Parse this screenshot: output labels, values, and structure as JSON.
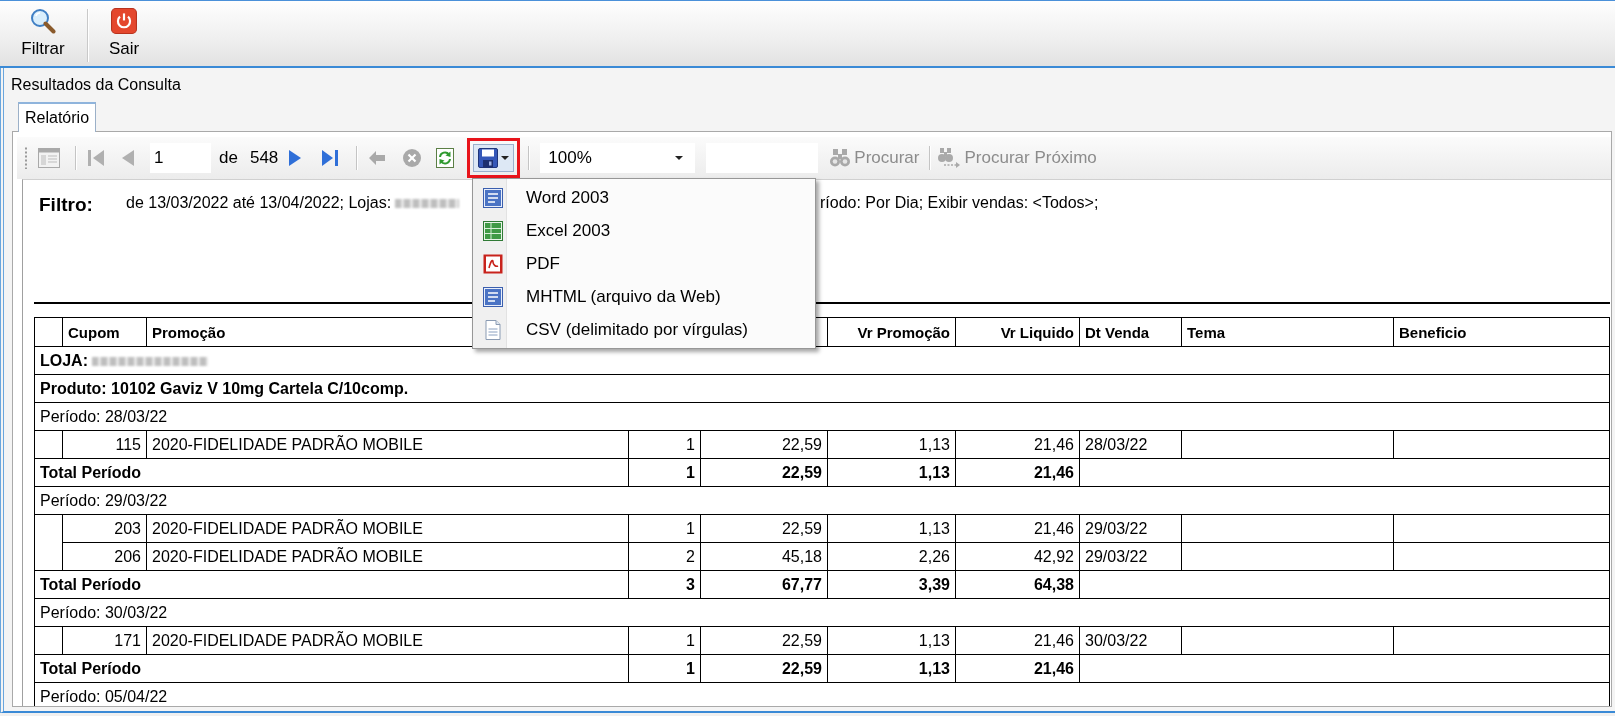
{
  "toolbar": {
    "buttons": [
      "Filtrar",
      "Sair"
    ]
  },
  "panel": {
    "title": "Resultados da Consulta"
  },
  "tabs": [
    {
      "label": "Relatório",
      "selected": true
    }
  ],
  "report_toolbar": {
    "document_map": {
      "disabled": true
    },
    "first_page": {
      "disabled": true
    },
    "previous_page": {
      "disabled": true
    },
    "page": "1",
    "page_of": "de",
    "page_count": "548",
    "next_page": {
      "disabled": false
    },
    "last_page": {
      "disabled": false
    },
    "back": {
      "disabled": true
    },
    "stop": {
      "disabled": true
    },
    "refresh": {
      "disabled": false
    },
    "export": {
      "expanded": true,
      "outlined": true
    },
    "zoom": "100%",
    "find": {
      "label": "Procurar",
      "disabled": true
    },
    "find_next": {
      "label": "Procurar Próximo",
      "disabled": true
    }
  },
  "export_menu": {
    "items": [
      "Word 2003",
      "Excel 2003",
      "PDF",
      "MHTML (arquivo da Web)",
      "CSV (delimitado por vírgulas)"
    ]
  },
  "report": {
    "filter_label": "Filtro:",
    "filter_text": "de 13/03/2022 até 13/04/2022; Lojas:",
    "filter_text_after_menu": "ríodo: Por Dia; Exibir vendas: <Todos>;",
    "table": {
      "columns": [
        null,
        "Cupom",
        "Promoção",
        null,
        null,
        "Vr Promoção",
        "Vr Liquido",
        "Dt Venda",
        "Tema",
        "Beneficio"
      ],
      "rows": [
        {
          "kind": "store",
          "label": "LOJA:"
        },
        {
          "kind": "product",
          "text": "Produto: 10102 Gaviz V 10mg Cartela C/10comp."
        },
        {
          "kind": "period",
          "text": "Período: 28/03/22"
        },
        {
          "kind": "items",
          "items": [
            [
              "115",
              "2020-FIDELIDADE PADRÃO MOBILE",
              "1",
              "22,59",
              "1,13",
              "21,46",
              "28/03/22"
            ]
          ]
        },
        {
          "kind": "total",
          "label": "Total Período",
          "values": [
            "1",
            "22,59",
            "1,13",
            "21,46"
          ]
        },
        {
          "kind": "period",
          "text": "Período: 29/03/22"
        },
        {
          "kind": "items",
          "items": [
            [
              "203",
              "2020-FIDELIDADE PADRÃO MOBILE",
              "1",
              "22,59",
              "1,13",
              "21,46",
              "29/03/22"
            ],
            [
              "206",
              "2020-FIDELIDADE PADRÃO MOBILE",
              "2",
              "45,18",
              "2,26",
              "42,92",
              "29/03/22"
            ]
          ]
        },
        {
          "kind": "total",
          "label": "Total Período",
          "values": [
            "3",
            "67,77",
            "3,39",
            "64,38"
          ]
        },
        {
          "kind": "period",
          "text": "Período: 30/03/22"
        },
        {
          "kind": "items",
          "items": [
            [
              "171",
              "2020-FIDELIDADE PADRÃO MOBILE",
              "1",
              "22,59",
              "1,13",
              "21,46",
              "30/03/22"
            ]
          ]
        },
        {
          "kind": "total",
          "label": "Total Período",
          "values": [
            "1",
            "22,59",
            "1,13",
            "21,46"
          ]
        },
        {
          "kind": "period",
          "text": "Período: 05/04/22"
        }
      ]
    }
  }
}
